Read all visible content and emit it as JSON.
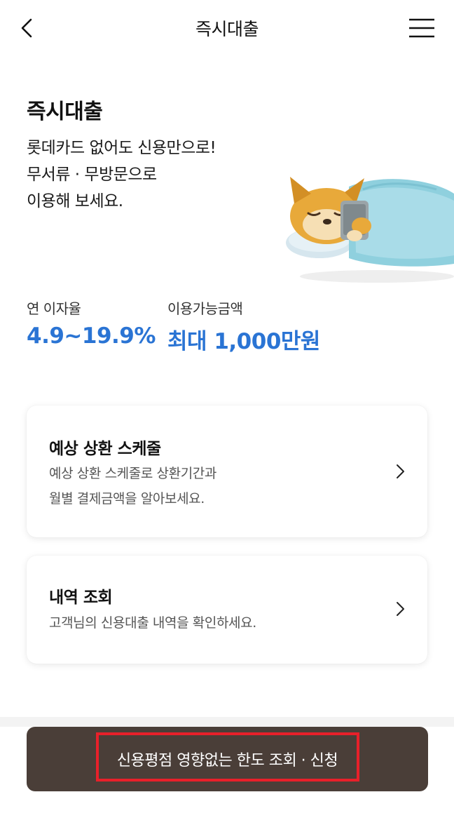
{
  "header": {
    "title": "즉시대출",
    "back_icon": "chevron-left-icon",
    "menu_icon": "hamburger-menu-icon"
  },
  "hero": {
    "title": "즉시대출",
    "desc_lines": [
      "롯데카드 없어도 신용만으로!",
      "무서류 · 무방문으로",
      "이용해 보세요."
    ],
    "illustration": "sleeping-dog-with-phone-illustration"
  },
  "stats": {
    "rate_label": "연 이자율",
    "rate_value": "4.9~19.9%",
    "limit_label": "이용가능금액",
    "limit_value": "최대 1,000만원",
    "accent_color": "#2a74d4"
  },
  "cards": [
    {
      "title": "예상 상환 스케줄",
      "desc_lines": [
        "예상 상환 스케줄로 상환기간과",
        "월별 결제금액을 알아보세요."
      ]
    },
    {
      "title": "내역 조회",
      "desc_lines": [
        "고객님의 신용대출 내역을 확인하세요."
      ]
    }
  ],
  "cta": {
    "label": "신용평점 영향없는 한도 조회 · 신청",
    "background": "#4a3e38",
    "highlight_color": "#e8202a"
  }
}
